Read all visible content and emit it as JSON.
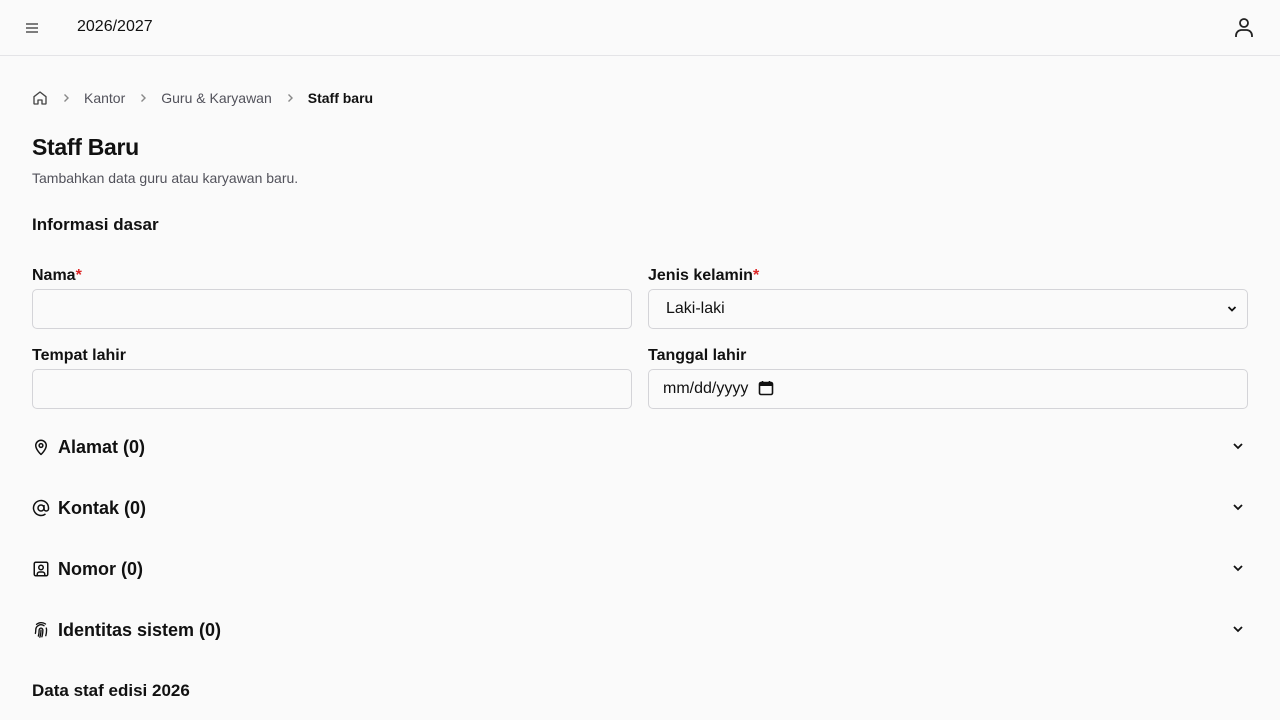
{
  "header": {
    "year": "2026/2027",
    "menu_icon": "hamburger-icon",
    "user_icon": "user-icon"
  },
  "breadcrumb": {
    "items": [
      "Kantor",
      "Guru & Karyawan"
    ],
    "current": "Staff baru"
  },
  "page": {
    "title": "Staff Baru",
    "subtitle": "Tambahkan data guru atau karyawan baru."
  },
  "basic_info": {
    "title": "Informasi dasar",
    "name": {
      "label": "Nama",
      "required": "*",
      "value": ""
    },
    "gender": {
      "label": "Jenis kelamin",
      "required": "*",
      "value": "Laki-laki"
    },
    "birthplace": {
      "label": "Tempat lahir",
      "value": ""
    },
    "birthdate": {
      "label": "Tanggal lahir",
      "placeholder": "mm/dd/yyyy"
    }
  },
  "accordions": [
    {
      "label": "Alamat (0)",
      "icon": "map-pin-icon"
    },
    {
      "label": "Kontak (0)",
      "icon": "at-sign-icon"
    },
    {
      "label": "Nomor (0)",
      "icon": "id-badge-icon"
    },
    {
      "label": "Identitas sistem (0)",
      "icon": "fingerprint-icon"
    }
  ],
  "staff_section": {
    "title": "Data staf edisi 2026"
  },
  "colors": {
    "required": "#dc2626",
    "border": "#d4d4d8",
    "background": "#fafafa"
  }
}
